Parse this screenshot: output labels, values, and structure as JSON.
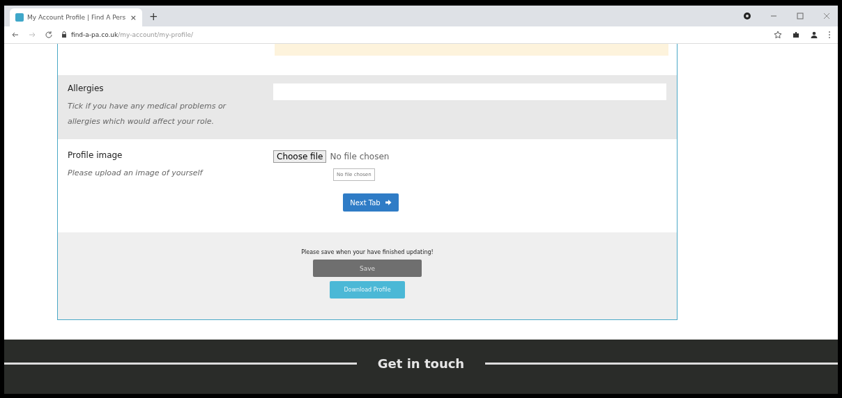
{
  "browser": {
    "tab_title": "My Account Profile | Find A Pers",
    "close_tab": "×",
    "new_tab": "+",
    "url_domain": "find-a-pa.co.uk",
    "url_path": "/my-account/my-profile/"
  },
  "fields": [
    {
      "kind": "text",
      "label": "Allergies",
      "hint": "Tick if you have any medical problems or allergies which would affect your role.",
      "shaded": true
    },
    {
      "kind": "file",
      "label": "Profile image",
      "hint": "Please upload an image of yourself",
      "shaded": false,
      "button": "Choose file",
      "status": "No file chosen",
      "preview": "No file chosen"
    }
  ],
  "next_button": "Next Tab",
  "save_note": "Please save when your have finished updating!",
  "save_button": "Save",
  "download_button": "Download Profile",
  "footer": {
    "heading": "Get in touch"
  }
}
